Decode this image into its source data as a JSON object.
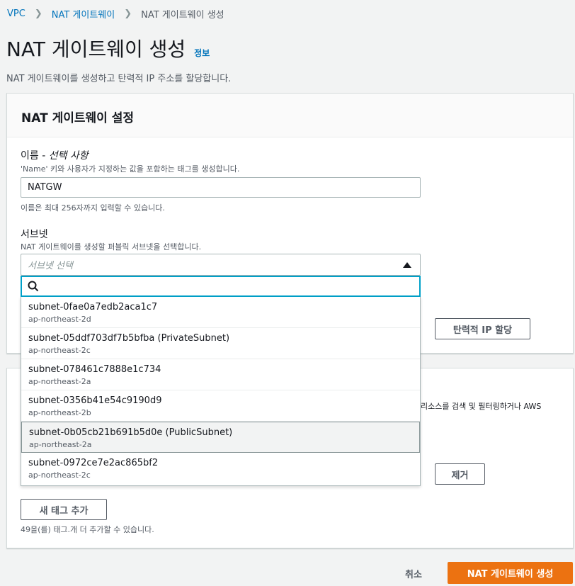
{
  "breadcrumb": {
    "items": [
      "VPC",
      "NAT 게이트웨이"
    ],
    "current": "NAT 게이트웨이 생성"
  },
  "page": {
    "title": "NAT 게이트웨이 생성",
    "info": "정보",
    "description": "NAT 게이트웨이를 생성하고 탄력적 IP 주소를 할당합니다."
  },
  "settings": {
    "header": "NAT 게이트웨이 설정",
    "name_label": "이름 - ",
    "name_optional": "선택 사항",
    "name_hint": "'Name' 키와 사용자가 지정하는 값을 포함하는 태그를 생성합니다.",
    "name_value": "NATGW",
    "name_limit": "이름은 최대 256자까지 입력할 수 있습니다.",
    "subnet_label": "서브넷",
    "subnet_hint": "NAT 게이트웨이를 생성할 퍼블릭 서브넷을 선택합니다.",
    "subnet_placeholder": "서브넷 선택",
    "search_value": "",
    "eip_button": "탄력적 IP 할당"
  },
  "subnets": [
    {
      "id": "subnet-0fae0a7edb2aca1c7",
      "az": "ap-northeast-2d"
    },
    {
      "id": "subnet-05ddf703df7b5bfba (PrivateSubnet)",
      "az": "ap-northeast-2c"
    },
    {
      "id": "subnet-078461c7888e1c734",
      "az": "ap-northeast-2a"
    },
    {
      "id": "subnet-0356b41e54c9190d9",
      "az": "ap-northeast-2b"
    },
    {
      "id": "subnet-0b05cb21b691b5d0e (PublicSubnet)",
      "az": "ap-northeast-2a"
    },
    {
      "id": "subnet-0972ce7e2ac865bf2",
      "az": "ap-northeast-2c"
    }
  ],
  "tags": {
    "partial_desc": "리소스를 검색 및 필터링하거나 AWS",
    "remove_button": "제거",
    "add_button": "새 태그 추가",
    "remaining": "49을(를) 태그.개 더 추가할 수 있습니다."
  },
  "footer": {
    "cancel": "취소",
    "create": "NAT 게이트웨이 생성"
  }
}
